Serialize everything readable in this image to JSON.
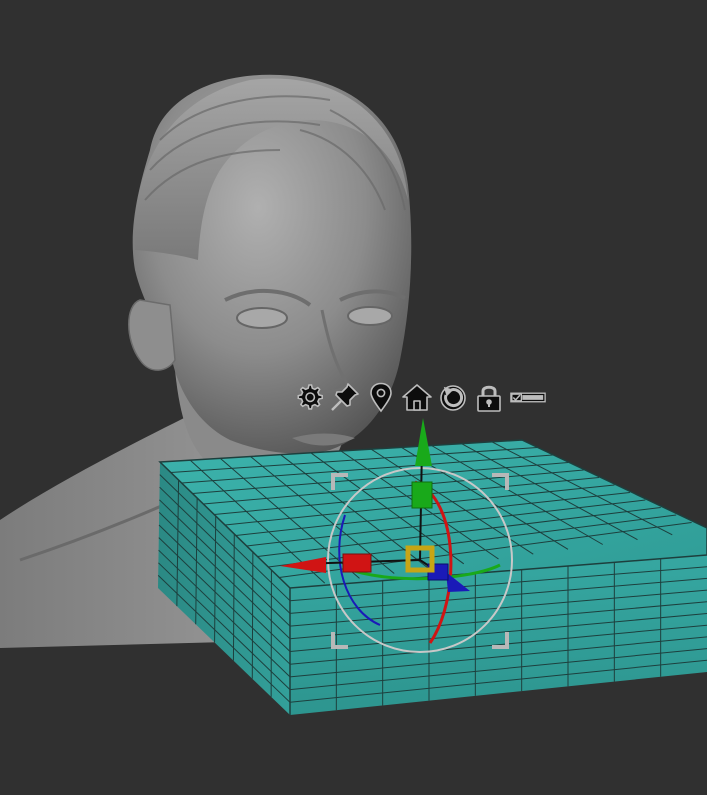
{
  "viewport": {
    "background": "#303030",
    "bust_color": "#9a9a9a",
    "box_color": "#35a6a0",
    "wire_color": "#1d3f3d"
  },
  "gizmo": {
    "axis_colors": {
      "x": "#d01414",
      "y": "#19a91a",
      "z": "#1a1ab8"
    },
    "center_color": "#c7a515",
    "ring_color": "#c8c8c8"
  },
  "toolbar": {
    "icons": [
      "gear-icon",
      "pin-icon",
      "location-icon",
      "home-icon",
      "reset-icon",
      "lock-icon",
      "toggle-icon"
    ]
  }
}
